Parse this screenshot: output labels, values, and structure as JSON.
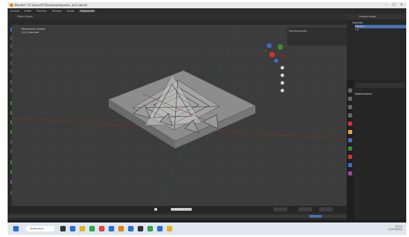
{
  "window": {
    "title": "Blender* [C:\\Users\\PC\\Downloads\\poster_blr2.blend]"
  },
  "menubar": {
    "items": [
      "Archivo",
      "Editar",
      "Procesar",
      "Ventana",
      "Ayuda"
    ],
    "active_tab": "Disposición"
  },
  "viewport": {
    "mode": "Modo Objeto",
    "view_label": "Perspectiva usuario",
    "collection_label": "(11) Colección",
    "transform_label": "Transformación"
  },
  "outliner": {
    "header": "Escena actual",
    "items": [
      "Colección",
      "Cámara",
      "Luz"
    ]
  },
  "properties": {
    "item": "Modificadores"
  },
  "taskbar": {
    "search_placeholder": "Búsqueda",
    "time": "15:43",
    "date": "17/07/2024"
  },
  "colors": {
    "accent": "#4772b3",
    "blender_orange": "#e87d0d"
  }
}
